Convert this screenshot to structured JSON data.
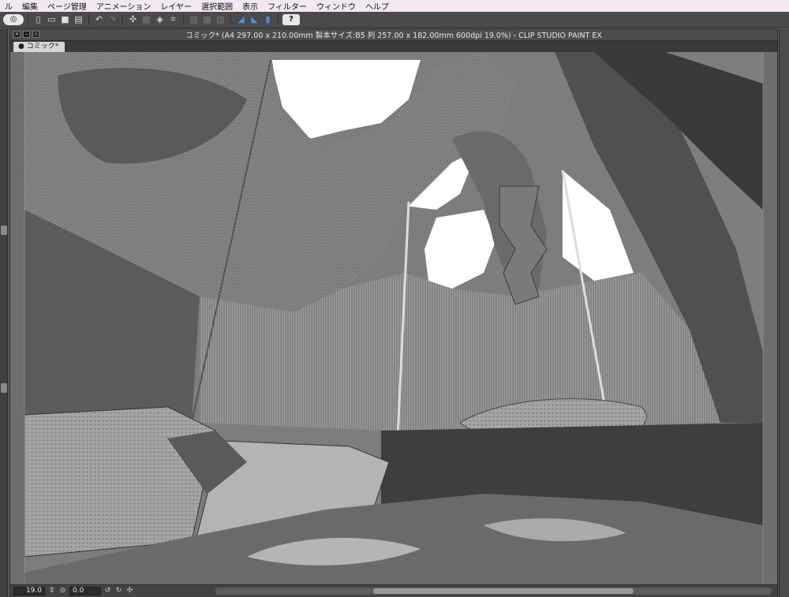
{
  "menu": [
    "ル",
    "編集",
    "ページ管理",
    "アニメーション",
    "レイヤー",
    "選択範囲",
    "表示",
    "フィルター",
    "ウィンドウ",
    "ヘルプ"
  ],
  "toolbar": {
    "logo_glyph": "◎",
    "help_glyph": "?",
    "icons": [
      "new-file-icon",
      "open-folder-icon",
      "save-icon",
      "print-icon",
      "undo-icon",
      "redo-icon",
      "transform-icon",
      "select-icon",
      "fill-icon",
      "crop-icon",
      "snap-ruler-icon",
      "snap-grid-icon",
      "snap-special-icon",
      "ruler-icon",
      "magnet-icon"
    ]
  },
  "document": {
    "title": "コミック* (A4 297.00 x 210.00mm 製本サイズ:B5 判 257.00 x 182.00mm 600dpi 19.0%)  - CLIP STUDIO PAINT EX",
    "tab_label": "コミック*"
  },
  "status": {
    "zoom": "19.0",
    "angle": "0.0"
  },
  "colors": {
    "menubar": "#f2e8ef",
    "toolbar": "#4a4a4a",
    "accent": "#4a8fe0"
  }
}
